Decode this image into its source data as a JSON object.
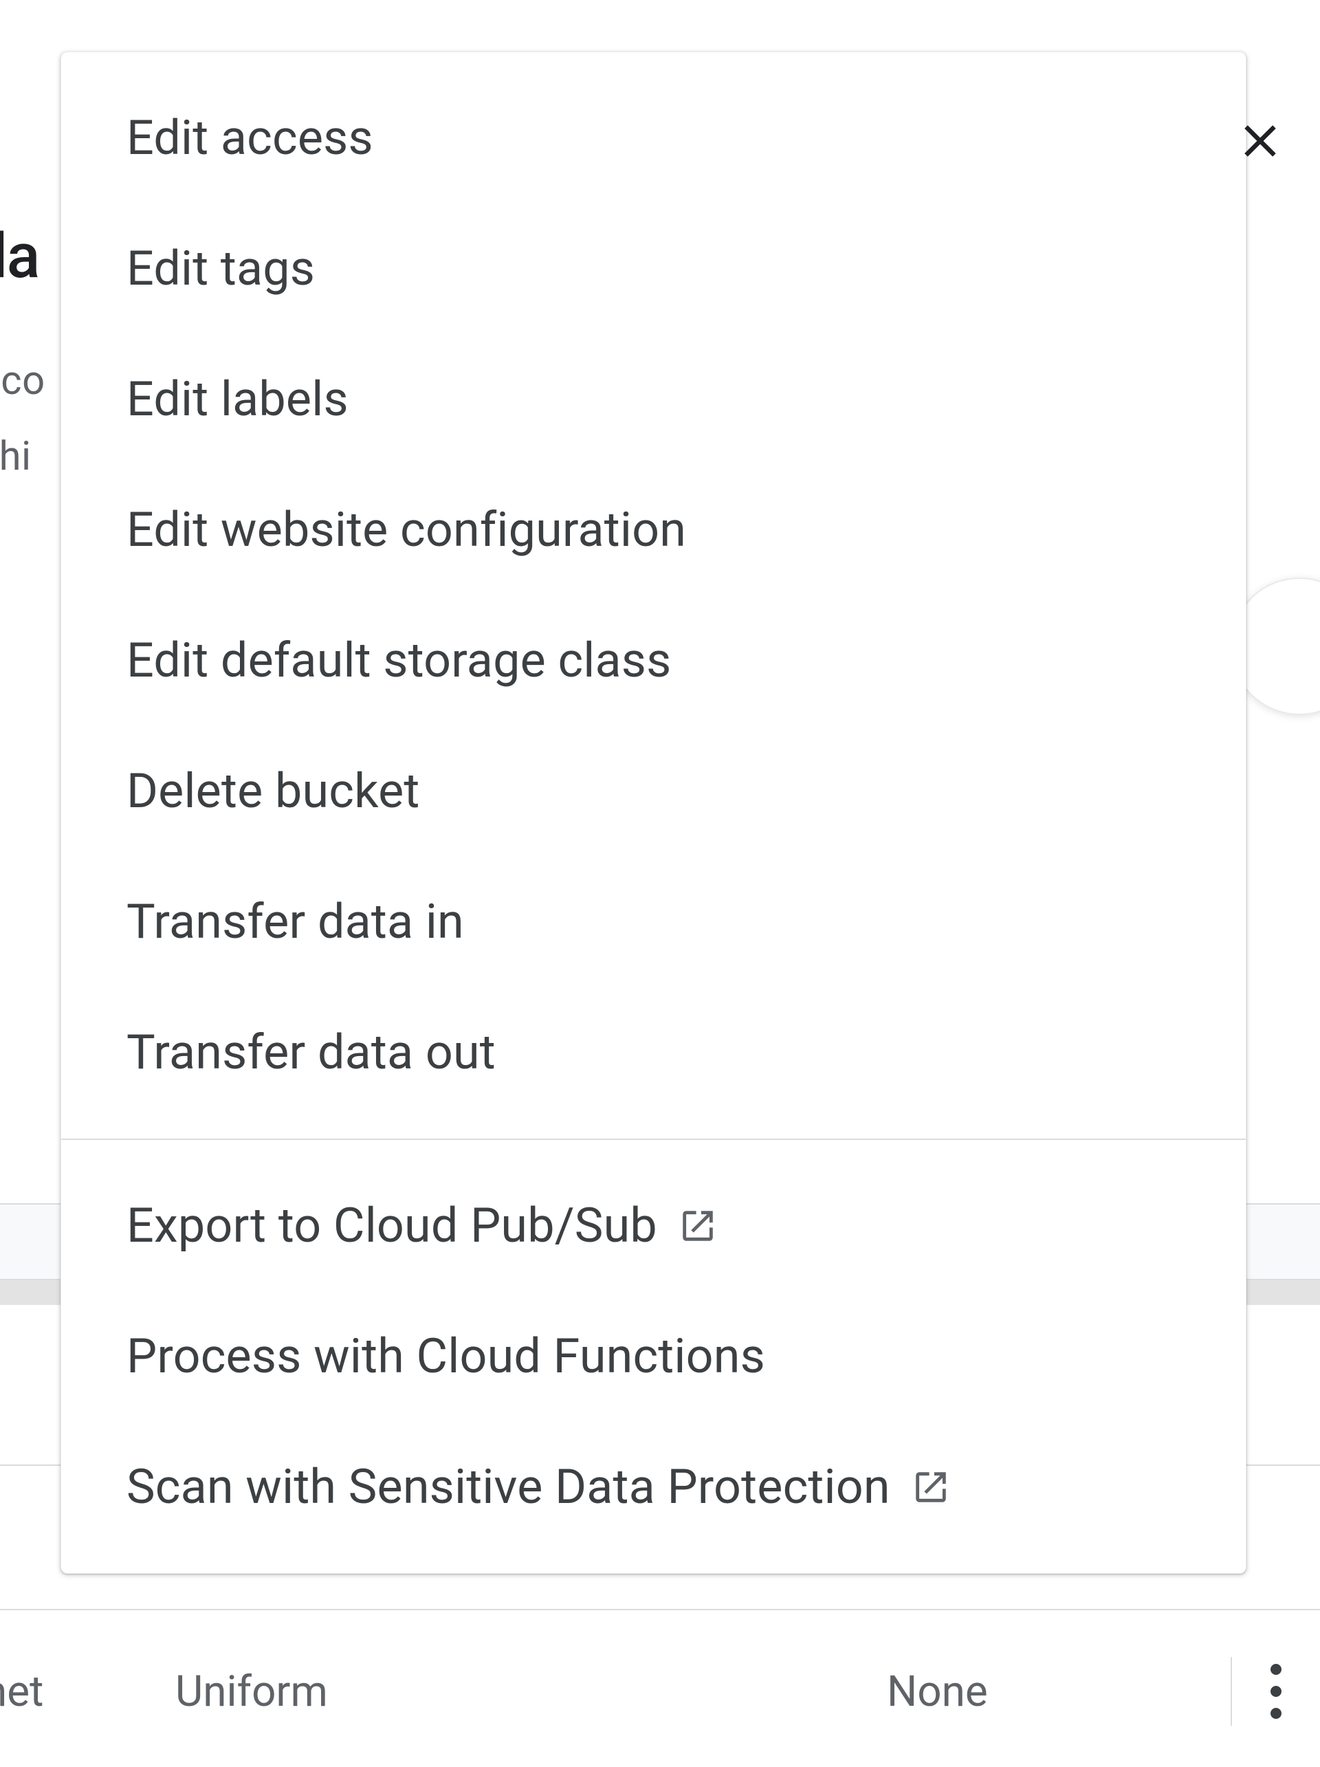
{
  "background": {
    "title_fragment": "da",
    "desc_line1_fragment": "eco",
    "desc_line2_fragment": "vhi",
    "row": {
      "cell1": "rnet",
      "cell2": "Uniform",
      "cell3": "None"
    }
  },
  "menu": {
    "section1": [
      {
        "label": "Edit access",
        "external": false
      },
      {
        "label": "Edit tags",
        "external": false
      },
      {
        "label": "Edit labels",
        "external": false
      },
      {
        "label": "Edit website configuration",
        "external": false
      },
      {
        "label": "Edit default storage class",
        "external": false
      },
      {
        "label": "Delete bucket",
        "external": false
      },
      {
        "label": "Transfer data in",
        "external": false
      },
      {
        "label": "Transfer data out",
        "external": false
      }
    ],
    "section2": [
      {
        "label": "Export to Cloud Pub/Sub",
        "external": true
      },
      {
        "label": "Process with Cloud Functions",
        "external": false
      },
      {
        "label": "Scan with Sensitive Data Protection",
        "external": true
      }
    ]
  }
}
